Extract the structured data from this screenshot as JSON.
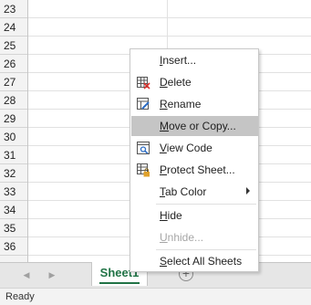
{
  "rows": [
    "23",
    "24",
    "25",
    "26",
    "27",
    "28",
    "29",
    "30",
    "31",
    "32",
    "33",
    "34",
    "35",
    "36"
  ],
  "sheet_tabs": {
    "active_label": "Sheet1"
  },
  "status": {
    "text": "Ready"
  },
  "context_menu": {
    "items": [
      {
        "key": "insert",
        "accel": "I",
        "rest": "nsert...",
        "icon": "none"
      },
      {
        "key": "delete",
        "accel": "D",
        "rest": "elete",
        "icon": "delete-sheet-icon"
      },
      {
        "key": "rename",
        "accel": "R",
        "rest": "ename",
        "icon": "rename-sheet-icon"
      },
      {
        "key": "move",
        "accel": "M",
        "rest": "ove or Copy...",
        "icon": "none",
        "highlighted": true
      },
      {
        "key": "view-code",
        "accel": "V",
        "rest": "iew Code",
        "icon": "view-code-icon"
      },
      {
        "key": "protect",
        "accel": "P",
        "rest": "rotect Sheet...",
        "icon": "protect-sheet-icon"
      },
      {
        "key": "tab-color",
        "accel": "T",
        "rest": "ab Color",
        "icon": "none",
        "submenu": true
      },
      {
        "key": "hide",
        "accel": "H",
        "rest": "ide",
        "icon": "none"
      },
      {
        "key": "unhide",
        "accel": "U",
        "rest": "nhide...",
        "icon": "none",
        "disabled": true
      },
      {
        "key": "select-all",
        "accel": "S",
        "rest": "elect All Sheets",
        "icon": "none"
      }
    ]
  },
  "colors": {
    "accent": "#217346",
    "highlight": "#c5c5c5",
    "disabled": "#a6a6a6"
  }
}
